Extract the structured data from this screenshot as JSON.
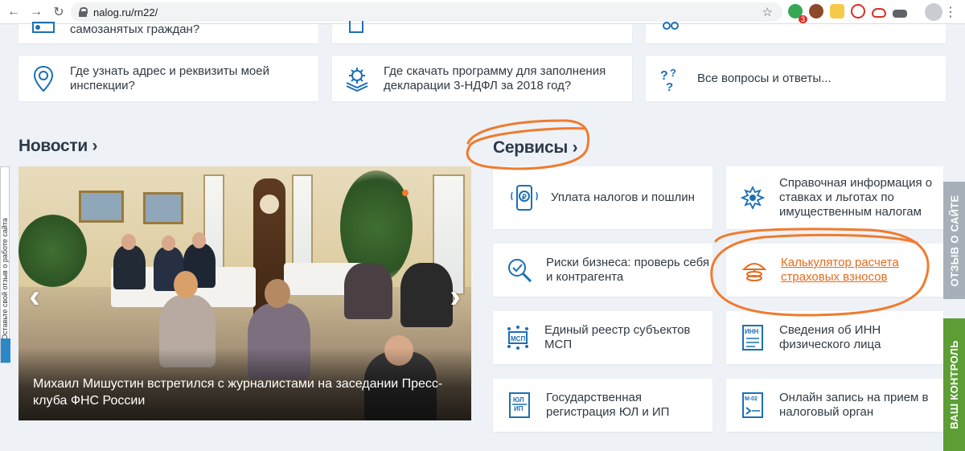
{
  "browser": {
    "url": "nalog.ru/rn22/",
    "ext_badge": "3"
  },
  "top_cards": [
    {
      "text": "самозанятых граждан?",
      "icon": "self-employed-icon"
    },
    {
      "text": "",
      "icon": "document-icon"
    },
    {
      "text": "",
      "icon": "people-icon"
    }
  ],
  "faq_cards": [
    {
      "text": "Где узнать адрес и реквизиты моей инспекции?",
      "icon": "location-pin-icon"
    },
    {
      "text": "Где скачать программу для заполнения декларации 3-НДФЛ за 2018 год?",
      "icon": "settings-icon"
    },
    {
      "text": "Все вопросы и ответы...",
      "icon": "question-marks-icon"
    }
  ],
  "news": {
    "title": "Новости",
    "chevron": "›",
    "caption": "Михаил Мишустин встретился с журналистами на заседании Пресс-клуба ФНС России"
  },
  "services": {
    "title": "Сервисы",
    "chevron": "›",
    "items": [
      {
        "text": "Уплата налогов и пошлин",
        "icon": "phone-ruble-icon"
      },
      {
        "text": "Справочная информация о ставках и льготах по имущественным налогам",
        "icon": "emblem-icon"
      },
      {
        "text": "Риски бизнеса: проверь себя и контрагента",
        "icon": "magnifier-check-icon"
      },
      {
        "text": "Калькулятор расчета страховых взносов",
        "icon": "umbrella-coins-icon",
        "link": true
      },
      {
        "text": "Единый реестр субъектов МСП",
        "icon": "msp-registry-icon"
      },
      {
        "text": "Сведения об ИНН физического лица",
        "icon": "inn-document-icon"
      },
      {
        "text": "Государственная регистрация ЮЛ и ИП",
        "icon": "ul-ip-document-icon"
      },
      {
        "text": "Онлайн запись на прием в налоговый орган",
        "icon": "m02-calendar-icon"
      }
    ]
  },
  "side_tabs": {
    "feedback": "ОТЗЫВ О САЙТЕ",
    "control": "ВАШ КОНТРОЛЬ",
    "left_feedback": "Оставьте свой отзыв о работе сайта",
    "feedback_color": "#a7b0b8",
    "control_color": "#5c9e35"
  },
  "colors": {
    "accent_orange": "#f07b2e",
    "icon_blue": "#1c6fb5",
    "link_orange": "#e46b1e"
  }
}
